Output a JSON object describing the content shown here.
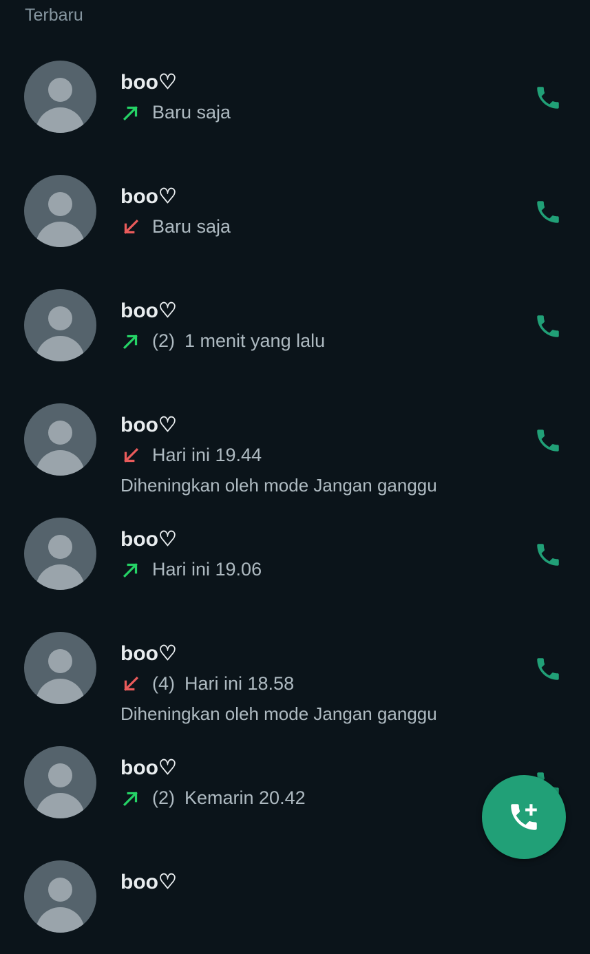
{
  "section_header": "Terbaru",
  "colors": {
    "background": "#0b141a",
    "outgoing_arrow": "#25d366",
    "missed_arrow": "#ea5b5b",
    "call_icon": "#21a077",
    "fab": "#21a077"
  },
  "calls": [
    {
      "name": "boo♡",
      "direction": "outgoing",
      "count": "",
      "time": "Baru saja",
      "note": ""
    },
    {
      "name": "boo♡",
      "direction": "missed",
      "count": "",
      "time": "Baru saja",
      "note": ""
    },
    {
      "name": "boo♡",
      "direction": "outgoing",
      "count": "(2)",
      "time": "1 menit yang lalu",
      "note": ""
    },
    {
      "name": "boo♡",
      "direction": "missed",
      "count": "",
      "time": "Hari ini 19.44",
      "note": "Diheningkan oleh mode Jangan ganggu"
    },
    {
      "name": "boo♡",
      "direction": "outgoing",
      "count": "",
      "time": "Hari ini 19.06",
      "note": ""
    },
    {
      "name": "boo♡",
      "direction": "missed",
      "count": "(4)",
      "time": "Hari ini 18.58",
      "note": "Diheningkan oleh mode Jangan ganggu"
    },
    {
      "name": "boo♡",
      "direction": "outgoing",
      "count": "(2)",
      "time": "Kemarin 20.42",
      "note": ""
    },
    {
      "name": "boo♡",
      "direction": "",
      "count": "",
      "time": "",
      "note": ""
    }
  ],
  "icons": {
    "avatar": "default-avatar-icon",
    "outgoing": "arrow-up-right-icon",
    "missed": "arrow-down-left-icon",
    "call": "phone-icon",
    "fab": "add-call-icon"
  }
}
